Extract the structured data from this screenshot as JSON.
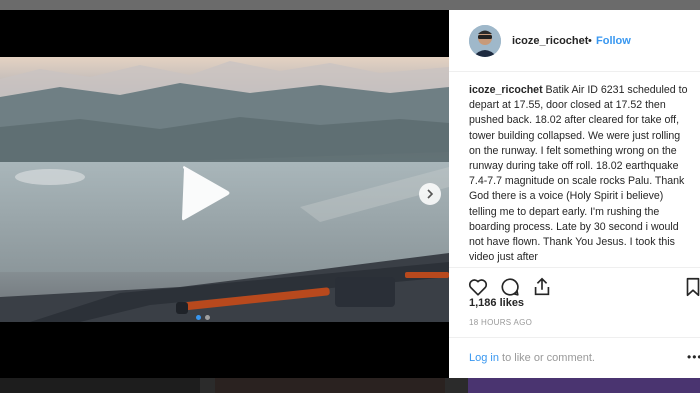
{
  "post": {
    "username": "icoze_ricochet",
    "separator": "•",
    "follow_label": "Follow",
    "caption_user": "icoze_ricochet",
    "caption_text": " Batik Air ID 6231 scheduled to depart at 17.55, door closed at 17.52 then pushed back. 18.02 after cleared for take off, tower building collapsed. We were just rolling on the runway. I felt something wrong on the runway during take off roll. 18.02 earthquake 7.4-7.7 magnitude on scale rocks Palu. Thank God there is a voice (Holy Spirit i believe) telling me to depart early. I'm rushing the boarding process. Late by 30 second i would not have flown. Thank You Jesus. I took this video just after",
    "likes": "1,186 likes",
    "time_ago": "18 HOURS AGO",
    "login_link": "Log in",
    "login_suffix": " to like or comment.",
    "more_label": "•••"
  },
  "media": {
    "carousel_count": 2,
    "active_index": 0
  },
  "icons": {
    "play": "play-icon",
    "next": "chevron-right-icon",
    "like": "heart-icon",
    "comment": "comment-icon",
    "share": "share-icon",
    "save": "bookmark-icon"
  },
  "colors": {
    "accent": "#3897f0",
    "text": "#262626",
    "muted": "#999999"
  }
}
